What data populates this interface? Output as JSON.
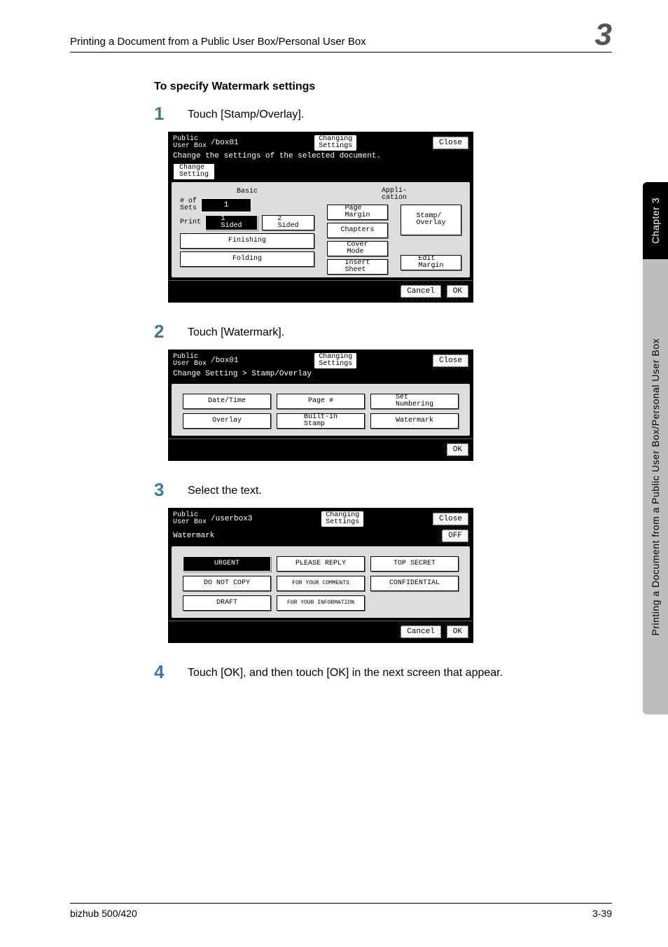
{
  "header": {
    "running_title": "Printing a Document from a Public User Box/Personal User Box",
    "chapter_glyph": "3"
  },
  "section_title": "To specify Watermark settings",
  "steps": {
    "s1": {
      "num": "1",
      "text": "Touch [Stamp/Overlay]."
    },
    "s2": {
      "num": "2",
      "text": "Touch [Watermark]."
    },
    "s3": {
      "num": "3",
      "text": "Select the text."
    },
    "s4": {
      "num": "4",
      "text": "Touch [OK], and then touch [OK] in the next screen that appear."
    }
  },
  "sidebar": {
    "chapter": "Chapter 3",
    "title": "Printing a Document from a Public User Box/Personal User Box"
  },
  "footer": {
    "left": "bizhub 500/420",
    "right": "3-39"
  },
  "shot1": {
    "boxlabel": "Public\nUser Box",
    "boxpath": "/box01",
    "tag": "Changing\nSettings",
    "close": "Close",
    "instruction": "Change the settings of the selected document.",
    "tab": "Change\nSetting",
    "col_basic": "Basic",
    "col_appli": "Appli-\ncation",
    "sets_label": "# of\nSets",
    "sets_value": "1",
    "print_label": "Print",
    "sided1": "1\nSided",
    "sided2": "2\nSided",
    "finishing": "Finishing",
    "folding": "Folding",
    "page_margin": "Page\nMargin",
    "chapters": "Chapters",
    "cover_mode": "Cover\nMode",
    "insert_sheet": "Insert\nSheet",
    "stamp_overlay": "Stamp/\nOverlay",
    "edit_margin": "Edit\nMargin",
    "cancel": "Cancel",
    "ok": "OK"
  },
  "shot2": {
    "boxlabel": "Public\nUser Box",
    "boxpath": "/box01",
    "tag": "Changing\nSettings",
    "close": "Close",
    "crumb": "Change Setting > Stamp/Overlay",
    "b1": "Date/Time",
    "b2": "Page #",
    "b3": "Set\nNumbering",
    "b4": "Overlay",
    "b5": "Built-in\nStamp",
    "b6": "Watermark",
    "ok": "OK"
  },
  "shot3": {
    "boxlabel": "Public\nUser Box",
    "boxpath": "/userbox3",
    "tag": "Changing\nSettings",
    "close": "Close",
    "title": "Watermark",
    "off": "OFF",
    "o1": "URGENT",
    "o2": "PLEASE REPLY",
    "o3": "TOP SECRET",
    "o4": "DO NOT COPY",
    "o5": "FOR YOUR COMMENTS",
    "o6": "CONFIDENTIAL",
    "o7": "DRAFT",
    "o8": "FOR YOUR INFORMATION",
    "cancel": "Cancel",
    "ok": "OK"
  }
}
